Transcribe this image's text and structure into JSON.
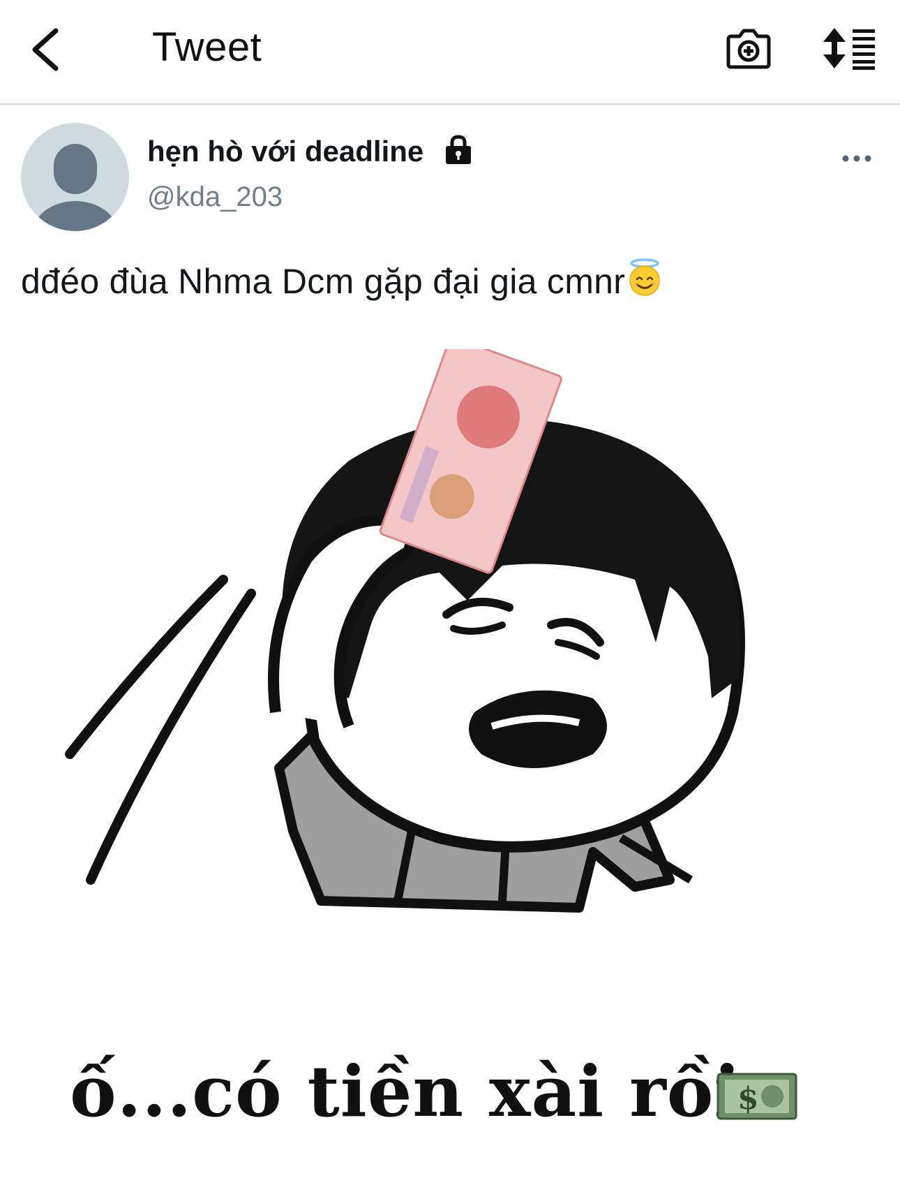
{
  "header": {
    "title": "Tweet",
    "back_icon": "chevron-left-icon",
    "camera_icon": "camera-plus-icon",
    "sort_icon": "sort-lines-icon"
  },
  "tweet": {
    "display_name": "hẹn hò với deadline",
    "protected_icon": "lock-icon",
    "handle": "@kda_203",
    "more_icon": "ellipsis-icon",
    "text": "dđéo đùa Nhma Dcm gặp đại gia cmnr",
    "text_emoji": "smiling-face-with-halo",
    "media": {
      "caption": "ố...có tiền xài rồi",
      "caption_emoji": "dollar-banknote",
      "description_icon": "meme-illustration"
    }
  },
  "colors": {
    "accent_text": "#14171a",
    "secondary_text": "#6e7f8c",
    "divider": "#d4d4d4",
    "avatar_bg": "#cfd9de",
    "avatar_fg": "#657786"
  }
}
